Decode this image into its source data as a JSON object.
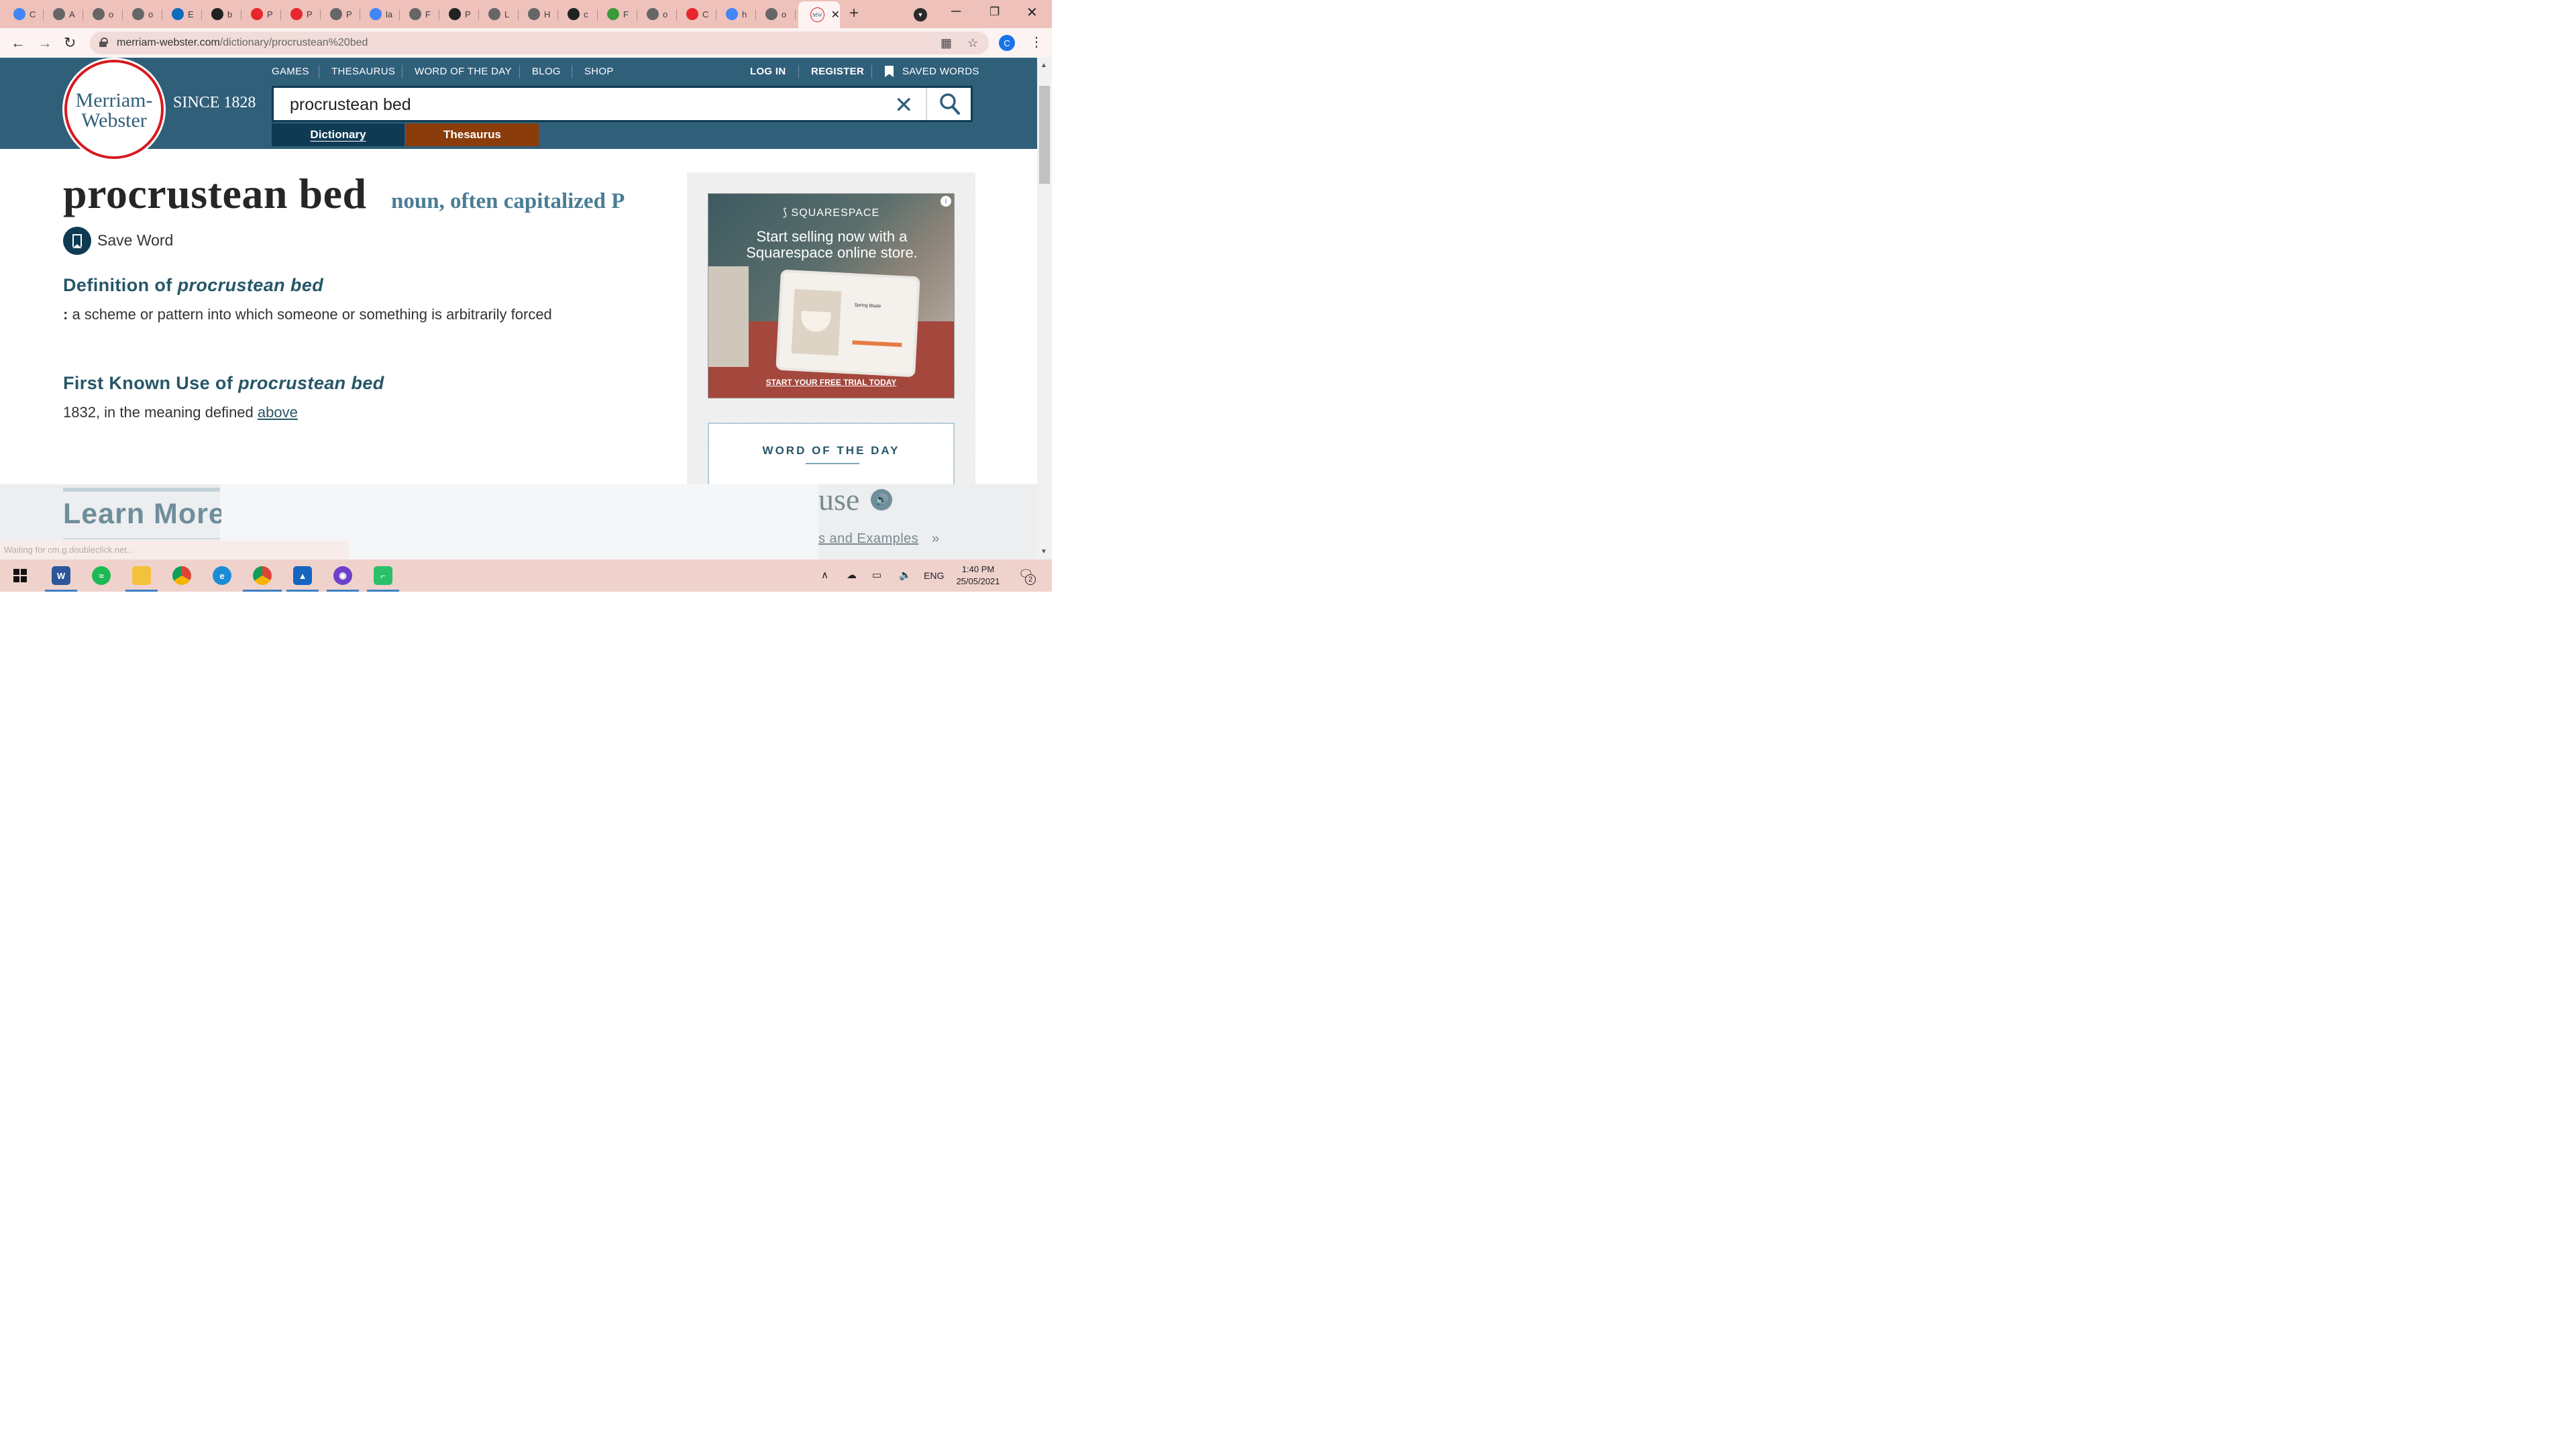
{
  "browser": {
    "tabs": [
      {
        "label": "C",
        "color": "#4285f4"
      },
      {
        "label": "A",
        "color": "#666666"
      },
      {
        "label": "o",
        "color": "#666666"
      },
      {
        "label": "o",
        "color": "#666666"
      },
      {
        "label": "E",
        "color": "#0f6cbd"
      },
      {
        "label": "b",
        "color": "#222222"
      },
      {
        "label": "P",
        "color": "#e8262b"
      },
      {
        "label": "P",
        "color": "#e8262b"
      },
      {
        "label": "P",
        "color": "#666666"
      },
      {
        "label": "la",
        "color": "#4285f4"
      },
      {
        "label": "F",
        "color": "#666666"
      },
      {
        "label": "P",
        "color": "#222222"
      },
      {
        "label": "L",
        "color": "#666666"
      },
      {
        "label": "H",
        "color": "#666666"
      },
      {
        "label": "c",
        "color": "#222222"
      },
      {
        "label": "F",
        "color": "#3b9a3b"
      },
      {
        "label": "o",
        "color": "#666666"
      },
      {
        "label": "C",
        "color": "#e8262b"
      },
      {
        "label": "h",
        "color": "#4285f4"
      },
      {
        "label": "o",
        "color": "#666666"
      }
    ],
    "active_tab_favicon": "MW",
    "url_domain": "merriam-webster.com",
    "url_path": "/dictionary/procrustean%20bed",
    "profile_initial": "C"
  },
  "site": {
    "logo_line1": "Merriam-",
    "logo_line2": "Webster",
    "since": "SINCE 1828",
    "nav": [
      "GAMES",
      "THESAURUS",
      "WORD OF THE DAY",
      "BLOG",
      "SHOP"
    ],
    "login": "LOG IN",
    "register": "REGISTER",
    "saved_words": "SAVED WORDS",
    "search_value": "procrustean bed",
    "tab_dictionary": "Dictionary",
    "tab_thesaurus": "Thesaurus"
  },
  "entry": {
    "headword": "procrustean bed",
    "function_label": "noun, often capitalized P",
    "save_word": "Save Word",
    "definition_heading_prefix": "Definition of ",
    "definition_heading_term": "procrustean bed",
    "definition_colon": ":",
    "definition_text": "a scheme or pattern into which someone or something is arbitrarily forced",
    "first_use_heading_prefix": "First Known Use of ",
    "first_use_heading_term": "procrustean bed",
    "first_use_text": "1832, in the meaning defined ",
    "first_use_link": "above",
    "learn_more": "Learn More"
  },
  "ad": {
    "brand": "SQUARESPACE",
    "headline": "Start selling now with a Squarespace online store.",
    "product_title": "Spring Blade",
    "cta": "START YOUR FREE TRIAL TODAY"
  },
  "wotd": {
    "label": "WORD OF THE DAY",
    "word_fragment": "use",
    "examples_fragment": "s and Examples",
    "examples_arrow": "»"
  },
  "status_text": "Waiting for cm.g.doubleclick.net...",
  "taskbar": {
    "language": "ENG",
    "time": "1:40 PM",
    "date": "25/05/2021",
    "notifications": "2"
  }
}
